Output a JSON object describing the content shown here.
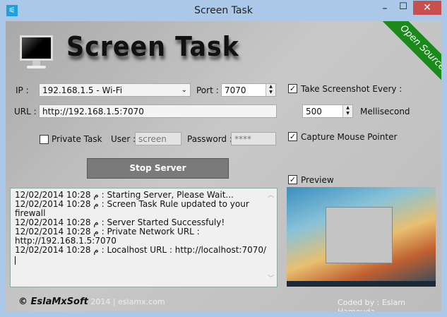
{
  "window": {
    "title": "Screen Task",
    "minimize": "–",
    "maximize": "☐",
    "close": "✕",
    "icon": "app-icon"
  },
  "header": {
    "app_title": "Screen Task",
    "ribbon": "Open Source"
  },
  "form": {
    "ip_label": "IP :",
    "ip_value": "192.168.1.5 - Wi-Fi",
    "port_label": "Port :",
    "port_value": "7070",
    "url_label": "URL :",
    "url_value": "http://192.168.1.5:7070",
    "private_label": "Private Task",
    "private_checked": false,
    "user_label": "User :",
    "user_value": "screen",
    "password_label": "Password :",
    "password_value": "****",
    "stop_button": "Stop Server"
  },
  "options": {
    "screenshot_label": "Take Screenshot Every :",
    "screenshot_checked": true,
    "interval_value": "500",
    "interval_unit": "Mellisecond",
    "mouse_label": "Capture Mouse Pointer",
    "mouse_checked": true,
    "preview_label": "Preview",
    "preview_checked": true
  },
  "log": [
    "12/02/2014 10:28 م : Starting Server, Please Wait...",
    "12/02/2014 10:28 م : Screen Task Rule updated to your firewall",
    "12/02/2014 10:28 م : Server Started Successfuly!",
    "12/02/2014 10:28 م : Private Network URL : http://192.168.1.5:7070",
    "12/02/2014 10:28 م : Localhost URL : http://localhost:7070/"
  ],
  "footer": {
    "brand": "© EslaMxSoft",
    "site": " 2014 | eslamx.com",
    "credit": "Coded by : Eslam Hamouda"
  }
}
